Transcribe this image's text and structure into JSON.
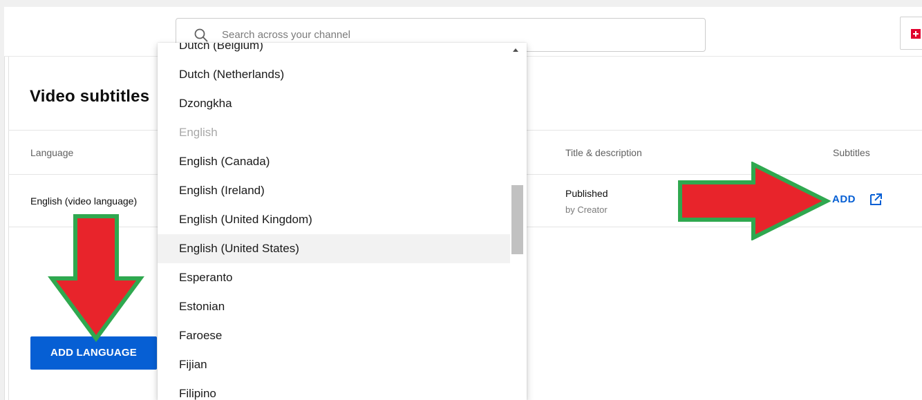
{
  "header": {
    "search_placeholder": "Search across your channel"
  },
  "card": {
    "title": "Video subtitles"
  },
  "table": {
    "columns": [
      "Language",
      "Title & description",
      "Subtitles"
    ],
    "row": {
      "language": "English (video language)",
      "title_status": "Published",
      "title_by": "by Creator",
      "subtitles_action": "ADD"
    }
  },
  "add_language_button": "ADD LANGUAGE",
  "dropdown": {
    "items": [
      {
        "label": "Dutch (Belgium)",
        "state": "normal"
      },
      {
        "label": "Dutch (Netherlands)",
        "state": "normal"
      },
      {
        "label": "Dzongkha",
        "state": "normal"
      },
      {
        "label": "English",
        "state": "disabled"
      },
      {
        "label": "English (Canada)",
        "state": "normal"
      },
      {
        "label": "English (Ireland)",
        "state": "normal"
      },
      {
        "label": "English (United Kingdom)",
        "state": "normal"
      },
      {
        "label": "English (United States)",
        "state": "hover"
      },
      {
        "label": "Esperanto",
        "state": "normal"
      },
      {
        "label": "Estonian",
        "state": "normal"
      },
      {
        "label": "Faroese",
        "state": "normal"
      },
      {
        "label": "Fijian",
        "state": "normal"
      },
      {
        "label": "Filipino",
        "state": "normal"
      }
    ]
  },
  "colors": {
    "accent": "#065fd4",
    "arrow_fill": "#e8242b",
    "arrow_outline": "#2fa84f",
    "create_icon": "#e1002d"
  },
  "icons": {
    "search": "search-icon",
    "external": "open-in-new-icon",
    "create": "create-plus-icon"
  }
}
